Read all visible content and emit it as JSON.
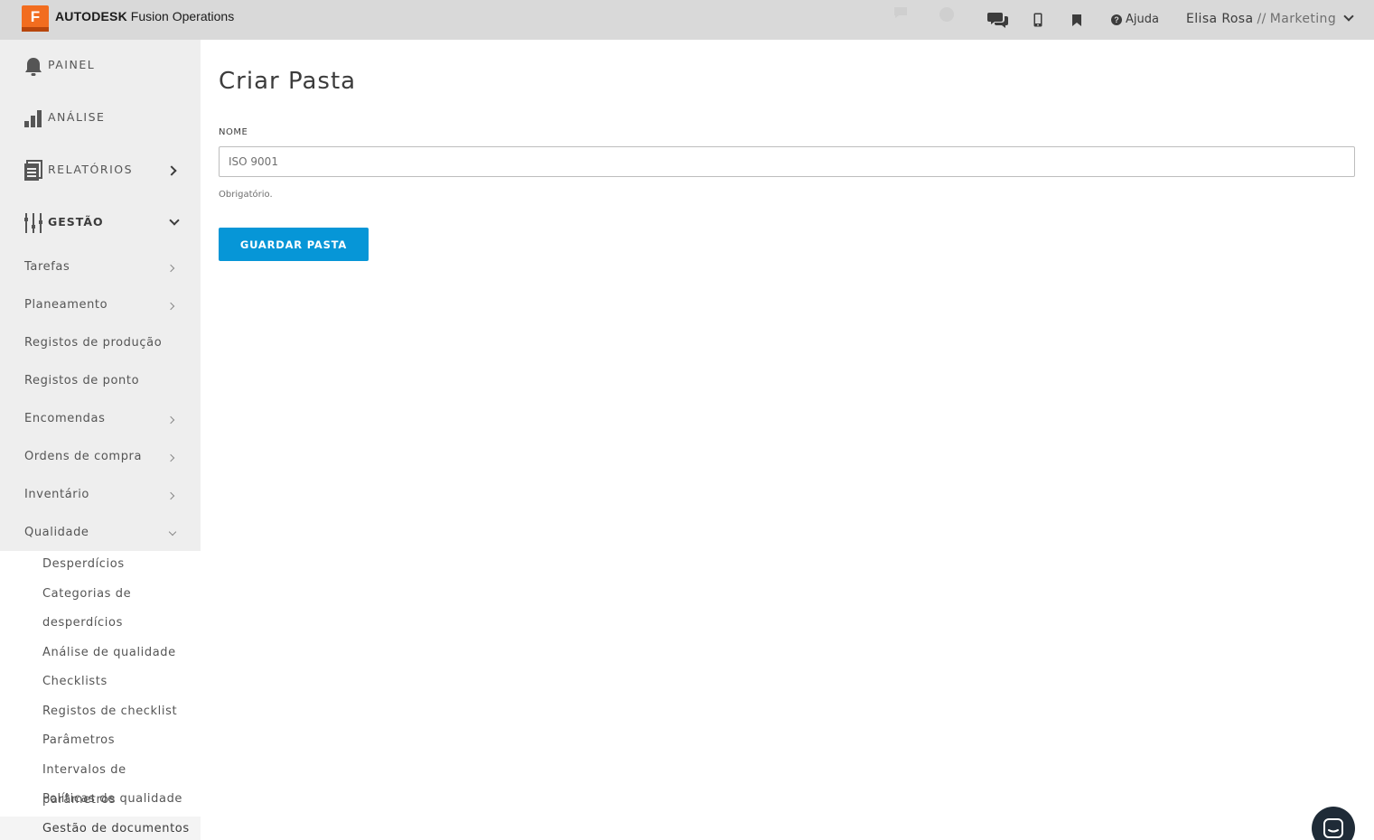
{
  "topbar": {
    "logo_letter": "F",
    "brand_strong": "AUTODESK",
    "brand_product": "Fusion Operations",
    "help_label": "Ajuda",
    "user_name": "Elisa Rosa",
    "user_separator": "//",
    "user_org": "Marketing",
    "icons": [
      "chat-icon",
      "mobile-icon",
      "bookmark-icon",
      "help-icon",
      "chevron-down-icon"
    ]
  },
  "sidebar": {
    "main": [
      {
        "label": "PAINEL",
        "icon": "bell-icon"
      },
      {
        "label": "ANÁLISE",
        "icon": "bar-chart-icon"
      },
      {
        "label": "RELATÓRIOS",
        "icon": "report-icon"
      },
      {
        "label": "GESTÃO",
        "icon": "sliders-icon"
      }
    ],
    "gestao": [
      {
        "label": "Tarefas"
      },
      {
        "label": "Planeamento"
      },
      {
        "label": "Registos de produção"
      },
      {
        "label": "Registos de ponto"
      },
      {
        "label": "Encomendas"
      },
      {
        "label": "Ordens de compra"
      },
      {
        "label": "Inventário"
      },
      {
        "label": "Qualidade"
      }
    ],
    "qualidade": [
      "Desperdícios",
      "Categorias de",
      "desperdícios",
      "Análise de qualidade",
      "Checklists",
      "Registos de checklist",
      "Parâmetros",
      "Intervalos de parâmetros",
      "Políticas de qualidade",
      "Gestão de documentos"
    ]
  },
  "main": {
    "title": "Criar Pasta",
    "name_label": "NOME",
    "name_value": "ISO 9001",
    "name_hint": "Obrigatório.",
    "save_label": "GUARDAR PASTA"
  },
  "colors": {
    "accent": "#0696d7",
    "logo": "#f26d1f",
    "topbar": "#d9d9d9",
    "sidebar": "#eeeeee"
  }
}
